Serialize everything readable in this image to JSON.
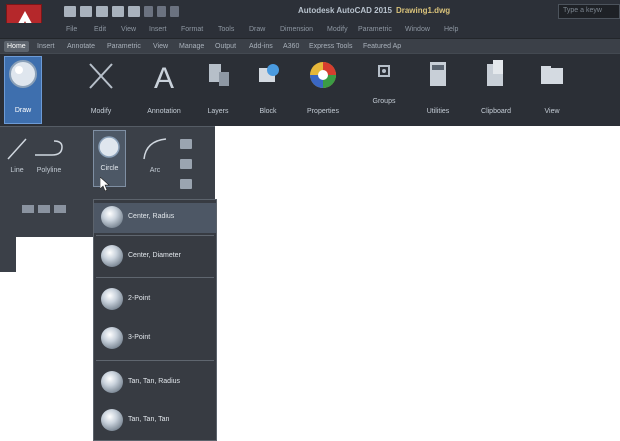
{
  "app": {
    "title": "Autodesk AutoCAD 2015",
    "filename": "Drawing1.dwg",
    "search_placeholder": "Type a keyw"
  },
  "menubar": {
    "items": [
      "File",
      "Edit",
      "View",
      "Insert",
      "Format",
      "Tools",
      "Draw",
      "Dimension",
      "Modify",
      "Parametric",
      "Window",
      "Help"
    ]
  },
  "ribbon_tabs": {
    "items": [
      "Home",
      "Insert",
      "Annotate",
      "Parametric",
      "View",
      "Manage",
      "Output",
      "Add-ins",
      "A360",
      "Express Tools",
      "Featured Ap"
    ],
    "active": "Home"
  },
  "ribbon_panels": {
    "items": [
      "Draw",
      "Modify",
      "Annotation",
      "Layers",
      "Block",
      "Properties",
      "Groups",
      "Utilities",
      "Clipboard",
      "View"
    ],
    "active": "Draw"
  },
  "draw_panel": {
    "line": "Line",
    "polyline": "Polyline",
    "circle": "Circle",
    "arc": "Arc"
  },
  "circle_dropdown": {
    "options": [
      "Center, Radius",
      "Center, Diameter",
      "2-Point",
      "3-Point",
      "Tan, Tan, Radius",
      "Tan, Tan, Tan"
    ],
    "highlighted": "Center, Radius"
  },
  "colors": {
    "accent": "#3e6fae",
    "logo": "#b5282b",
    "ribbon_bg": "#2b2f36"
  }
}
